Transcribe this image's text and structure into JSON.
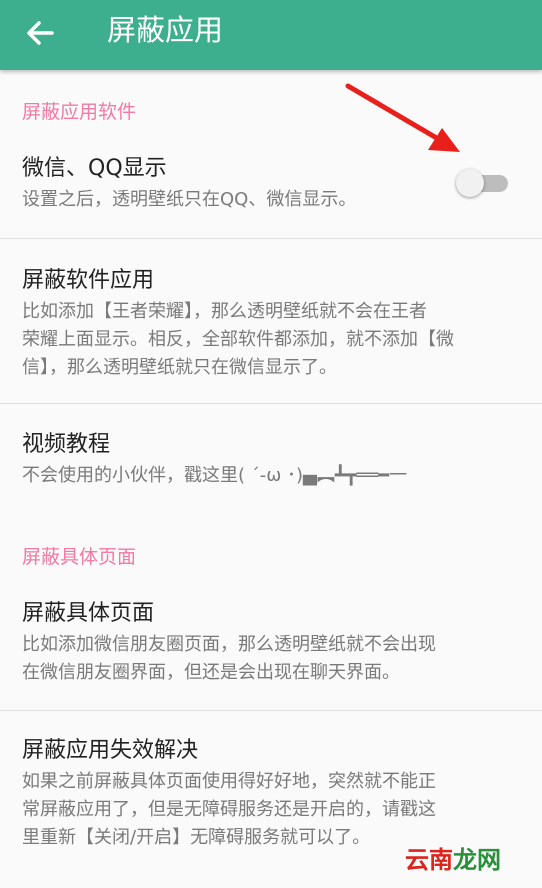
{
  "appbar": {
    "title": "屏蔽应用",
    "back_icon": "arrow-left-icon"
  },
  "sections": {
    "apps": {
      "header": "屏蔽应用软件"
    },
    "pages": {
      "header": "屏蔽具体页面"
    }
  },
  "items": {
    "wechat_qq": {
      "title": "微信、QQ显示",
      "subtitle": "设置之后，透明壁纸只在QQ、微信显示。",
      "toggle_on": false
    },
    "block_apps": {
      "title": "屏蔽软件应用",
      "subtitle_lines": [
        "比如添加【王者荣耀】，那么透明壁纸就不会在王者",
        "荣耀上面显示。相反，全部软件都添加，就不添加【微",
        "信】，那么透明壁纸就只在微信显示了。"
      ]
    },
    "video": {
      "title": "视频教程",
      "subtitle": "不会使用的小伙伴，戳这里( ´-ω ･)▄︻┻┳══━一"
    },
    "block_pages": {
      "title": "屏蔽具体页面",
      "subtitle_lines": [
        "比如添加微信朋友圈页面，那么透明壁纸就不会出现",
        "在微信朋友圈界面，但还是会出现在聊天界面。"
      ]
    },
    "fix": {
      "title": "屏蔽应用失效解决",
      "subtitle_lines": [
        "如果之前屏蔽具体页面使用得好好地，突然就不能正",
        "常屏蔽应用了，但是无障碍服务还是开启的，请戳这",
        "里重新【关闭/开启】无障碍服务就可以了。"
      ]
    }
  },
  "watermark": {
    "part1": "云南",
    "part2": "龙网"
  },
  "colors": {
    "appbar": "#3daf8e",
    "section_header": "#f27aa3",
    "arrow": "#e8201c"
  }
}
